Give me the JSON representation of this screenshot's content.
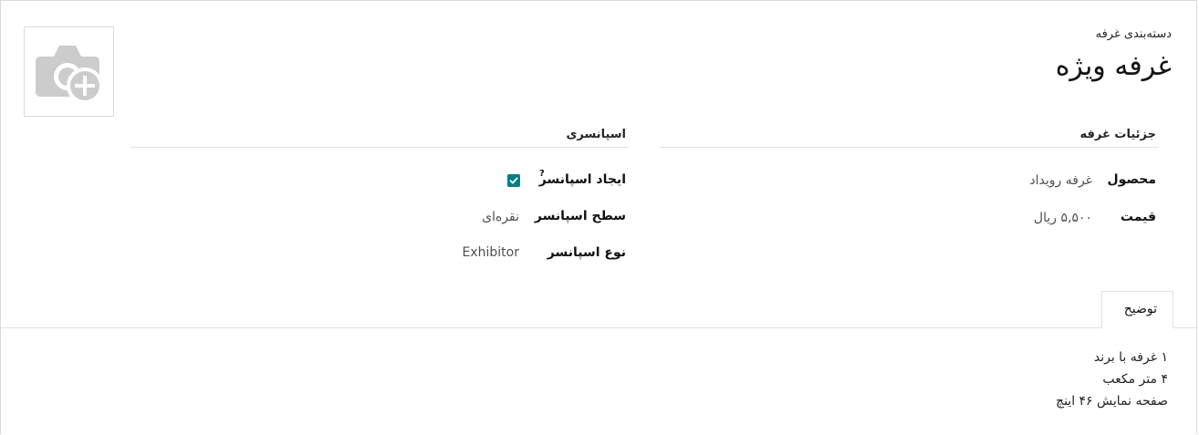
{
  "header": {
    "subtitle": "دسته‌بندی غرفه",
    "title": "غرفه ویژه"
  },
  "booth_details": {
    "title": "جزئیات غرفه",
    "product_label": "محصول",
    "product_value": "غرفه رویداد",
    "price_label": "قیمت",
    "price_value": "۵,۵۰۰ ریال"
  },
  "sponsorship": {
    "title": "اسپانسری",
    "create_sponsor_label": "ایجاد اسپانسر",
    "create_sponsor_help": "?",
    "create_sponsor_checked": true,
    "sponsor_level_label": "سطح اسپانسر",
    "sponsor_level_value": "نقره‌ای",
    "sponsor_type_label": "نوع اسپانسر",
    "sponsor_type_value": "Exhibitor"
  },
  "tabs": [
    {
      "label": "توضیح",
      "active": true
    }
  ],
  "description": {
    "lines": [
      "۱ غرفه با برند",
      "۴ متر مکعب",
      "صفحه نمایش ۴۶ اینچ"
    ]
  },
  "colors": {
    "accent": "#017e84",
    "placeholder_icon": "#cccccc"
  },
  "icons": {
    "avatar_placeholder": "camera-plus-icon",
    "checkbox": "check-icon"
  }
}
